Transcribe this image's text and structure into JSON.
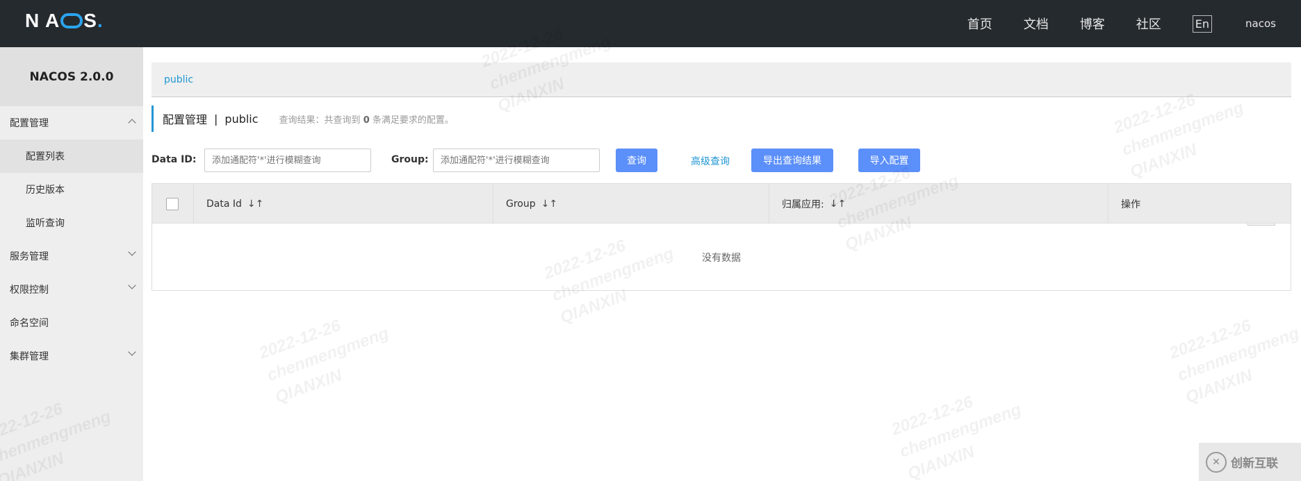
{
  "app": {
    "logo": "NACOS.",
    "version": "NACOS 2.0.0"
  },
  "nav": {
    "items": [
      "首页",
      "文档",
      "博客",
      "社区"
    ],
    "lang": "En",
    "user": "nacos"
  },
  "sidebar": {
    "items": [
      {
        "label": "配置管理",
        "type": "group",
        "expanded": true
      },
      {
        "label": "配置列表",
        "type": "sub",
        "active": true
      },
      {
        "label": "历史版本",
        "type": "sub"
      },
      {
        "label": "监听查询",
        "type": "sub"
      },
      {
        "label": "服务管理",
        "type": "group",
        "expanded": false
      },
      {
        "label": "权限控制",
        "type": "group",
        "expanded": false
      },
      {
        "label": "命名空间",
        "type": "plain"
      },
      {
        "label": "集群管理",
        "type": "group",
        "expanded": false
      }
    ]
  },
  "main": {
    "namespace_tab": "public",
    "title": "配置管理",
    "title_sep": "|",
    "title_ns": "public",
    "result_prefix": "查询结果：共查询到",
    "result_count": "0",
    "result_suffix": "条满足要求的配置。",
    "form": {
      "dataid_label": "Data ID:",
      "dataid_placeholder": "添加通配符'*'进行模糊查询",
      "group_label": "Group:",
      "group_placeholder": "添加通配符'*'进行模糊查询",
      "query_btn": "查询",
      "advanced_link": "高级查询",
      "export_btn": "导出查询结果",
      "import_btn": "导入配置"
    },
    "table": {
      "columns": [
        "Data Id",
        "Group",
        "归属应用:",
        "操作"
      ],
      "empty_text": "没有数据"
    }
  },
  "watermark": {
    "date": "2022-12-26",
    "name": "chenmengmeng",
    "org": "QIANXIN"
  },
  "brand": {
    "text": "创新互联"
  },
  "colors": {
    "topbar": "#252a2f",
    "accent": "#2196d3",
    "button": "#5b8ff9"
  }
}
